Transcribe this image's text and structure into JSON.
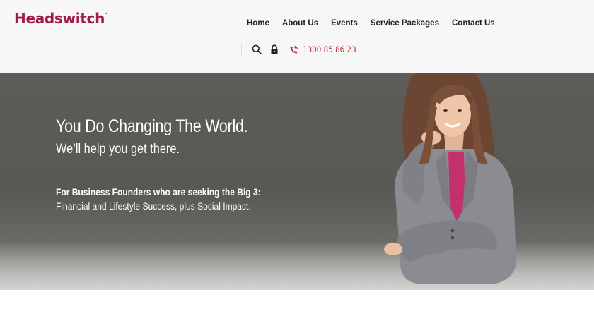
{
  "brand": {
    "logo_text": "Headswitch",
    "trademark": ".",
    "color": "#a3194a"
  },
  "nav": {
    "items": [
      {
        "label": "Home"
      },
      {
        "label": "About Us"
      },
      {
        "label": "Events"
      },
      {
        "label": "Service Packages"
      },
      {
        "label": "Contact Us"
      }
    ]
  },
  "utility": {
    "icons": [
      "search-icon",
      "lock-icon",
      "phone-icon"
    ],
    "phone_number": "1300 85 86 23",
    "accent": "#b82532"
  },
  "hero": {
    "title": "You Do Changing The World.",
    "subtitle": "We’ll help you get there.",
    "tagline_bold": "For Business Founders who are seeking the Big 3:",
    "tagline": "Financial and Lifestyle Success, plus Social Impact."
  }
}
